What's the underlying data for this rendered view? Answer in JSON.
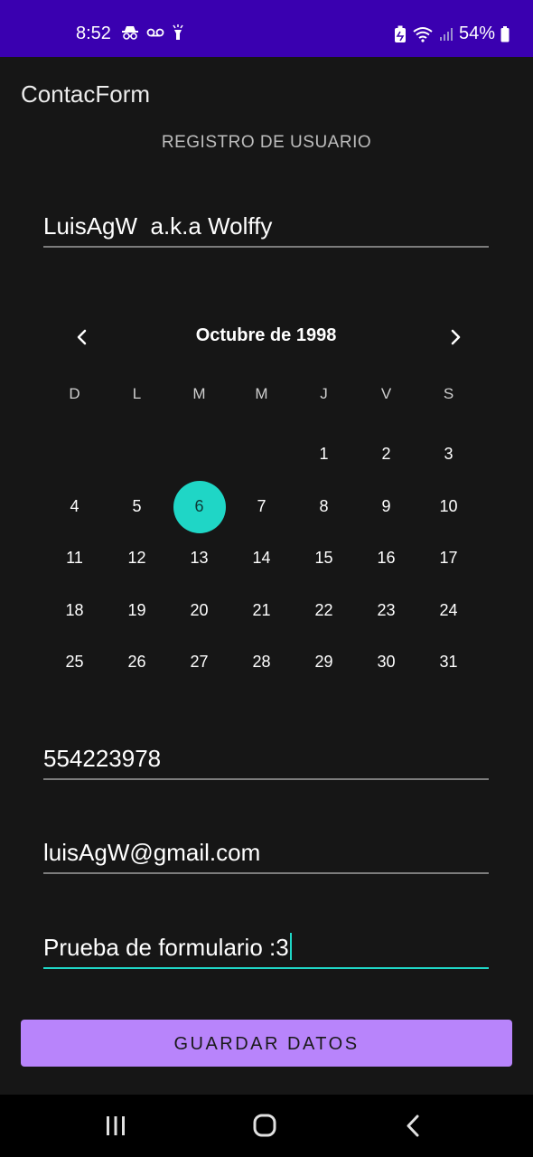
{
  "status_bar": {
    "time": "8:52",
    "battery": "54%",
    "left_icons": [
      "incognito-icon",
      "voicemail-icon",
      "flashlight-icon"
    ],
    "right_icons": [
      "battery-saver-icon",
      "wifi-icon",
      "signal-icon",
      "battery-icon"
    ],
    "background": "#3a00b0"
  },
  "app_bar": {
    "title": "ContacForm"
  },
  "form": {
    "subtitle": "REGISTRO DE USUARIO",
    "name_value": "LuisAgW  a.k.a Wolffy",
    "phone_value": "554223978",
    "email_value": "luisAgW@gmail.com",
    "description_value": "Prueba de formulario :3"
  },
  "calendar": {
    "month_label": "Octubre de 1998",
    "weekdays": [
      "D",
      "L",
      "M",
      "M",
      "J",
      "V",
      "S"
    ],
    "weeks": [
      [
        "",
        "",
        "",
        "",
        "1",
        "2",
        "3"
      ],
      [
        "4",
        "5",
        "6",
        "7",
        "8",
        "9",
        "10"
      ],
      [
        "11",
        "12",
        "13",
        "14",
        "15",
        "16",
        "17"
      ],
      [
        "18",
        "19",
        "20",
        "21",
        "22",
        "23",
        "24"
      ],
      [
        "25",
        "26",
        "27",
        "28",
        "29",
        "30",
        "31"
      ]
    ],
    "selected_day": "6",
    "accent_color": "#1fd6c6"
  },
  "actions": {
    "save_label": "GUARDAR DATOS",
    "save_color": "#b884fb"
  },
  "nav_bar": {
    "buttons": [
      "recents-icon",
      "home-icon",
      "back-icon"
    ]
  }
}
